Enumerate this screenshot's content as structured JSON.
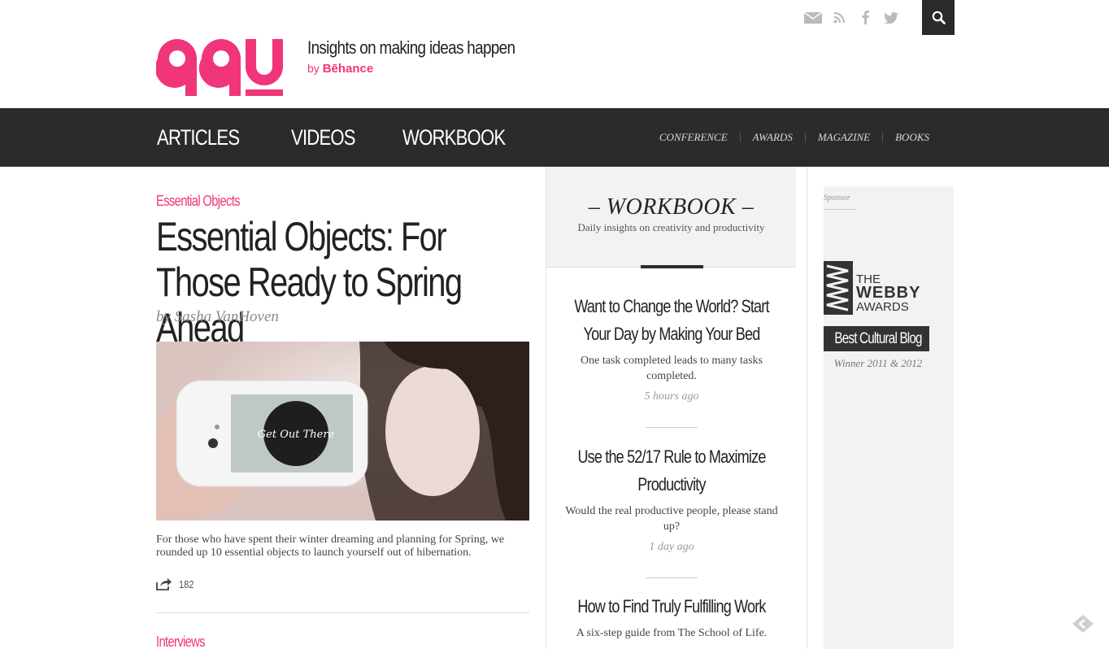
{
  "brand": {
    "logo_text": "99u",
    "tagline": "Insights on making ideas happen",
    "by_prefix": "by",
    "by_brand": "Bēhance",
    "accent_color": "#f0357b"
  },
  "header_icons": [
    "mail-icon",
    "rss-icon",
    "facebook-icon",
    "twitter-icon",
    "search-icon"
  ],
  "nav": {
    "main": [
      "ARTICLES",
      "VIDEOS",
      "WORKBOOK"
    ],
    "secondary": [
      "CONFERENCE",
      "AWARDS",
      "MAGAZINE",
      "BOOKS"
    ]
  },
  "article": {
    "category": "Essential Objects",
    "title": "Essential Objects: For Those Ready to Spring Ahead",
    "byline": "by Sasha VanHoven",
    "image_text": "Get Out There",
    "summary": "For those who have spent their winter dreaming and planning for Spring, we rounded up 10 essential objects to launch yourself out of hibernation.",
    "share_count": "182",
    "next_category": "Interviews"
  },
  "workbook": {
    "title": "– WORKBOOK –",
    "subtitle": "Daily insights on creativity and productivity",
    "items": [
      {
        "title": "Want to Change the World? Start Your Day by Making Your Bed",
        "desc": "One task completed leads to many tasks completed.",
        "time": "5 hours ago"
      },
      {
        "title": "Use the 52/17 Rule to Maximize Productivity",
        "desc": "Would the real productive people, please stand up?",
        "time": "1 day ago"
      },
      {
        "title": "How to Find Truly Fulfilling Work",
        "desc": "A six-step guide from The School of Life.",
        "time": ""
      }
    ]
  },
  "sponsor": {
    "label": "Sponsor",
    "webby_line1": "THE",
    "webby_line2": "WEBBY",
    "webby_line3": "AWARDS",
    "badge": "Best Cultural Blog",
    "winner": "Winner 2011 & 2012"
  }
}
